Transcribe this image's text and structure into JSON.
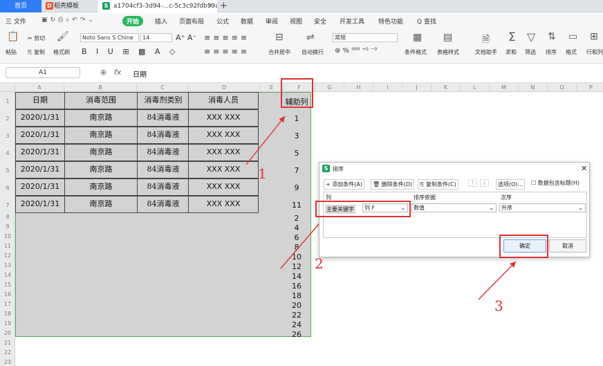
{
  "tabs": {
    "home": "首页",
    "template": "稻壳模板",
    "doc": "a1704cf3-3d94-...c-5c3c92fdb99a"
  },
  "menu": {
    "file": "三 文件",
    "start": "开始",
    "items": [
      "插入",
      "页面布局",
      "公式",
      "数据",
      "审阅",
      "视图",
      "安全",
      "开发工具",
      "特色功能"
    ],
    "search": "Q 查找"
  },
  "ribbon": {
    "paste": "粘贴",
    "cut": "剪切",
    "copy": "复制",
    "format_painter": "格式刷",
    "font": "Noto Sans S Chine",
    "size": "14",
    "merge": "合并居中",
    "wrap": "自动换行",
    "numfmt": "常规",
    "cond": "条件格式",
    "tablestyle": "表格样式",
    "helper": "文档助手",
    "sum": "求和",
    "filter": "筛选",
    "sort": "排序",
    "format": "格式",
    "rowcol": "行和列"
  },
  "formula": {
    "cell": "A1",
    "fx": "fx",
    "value": "日期"
  },
  "columns": [
    "A",
    "B",
    "C",
    "D",
    "E",
    "F",
    "G",
    "H",
    "I",
    "J",
    "K",
    "L",
    "M",
    "N",
    "O",
    "P"
  ],
  "table": {
    "headers": [
      "日期",
      "消毒范围",
      "消毒剂类别",
      "消毒人员"
    ],
    "rows": [
      [
        "2020/1/31",
        "南京路",
        "84消毒液",
        "XXX XXX"
      ],
      [
        "2020/1/31",
        "南京路",
        "84消毒液",
        "XXX XXX"
      ],
      [
        "2020/1/31",
        "南京路",
        "84消毒液",
        "XXX XXX"
      ],
      [
        "2020/1/31",
        "南京路",
        "84消毒液",
        "XXX XXX"
      ],
      [
        "2020/1/31",
        "南京路",
        "84消毒液",
        "XXX XXX"
      ],
      [
        "2020/1/31",
        "南京路",
        "84消毒液",
        "XXX XXX"
      ]
    ]
  },
  "helper_col": {
    "header": "辅助列",
    "values": [
      "1",
      "3",
      "5",
      "7",
      "9",
      "11",
      "2",
      "4",
      "6",
      "8",
      "10",
      "12",
      "14",
      "16",
      "18",
      "20",
      "22",
      "24",
      "26"
    ]
  },
  "annotations": [
    "1",
    "2",
    "3"
  ],
  "dialog": {
    "title": "排序",
    "add": "+ 添加条件(A)",
    "delete": "删除条件(D)",
    "copy": "复制条件(C)",
    "options": "选项(O)...",
    "header_check": "数据包含标题(H)",
    "col_label": "列",
    "sortby_label": "排序依据",
    "order_label": "次序",
    "key": "主要关键字",
    "key_col": "列 F",
    "sortby": "数值",
    "order": "升序",
    "ok": "确定",
    "cancel": "取消"
  }
}
